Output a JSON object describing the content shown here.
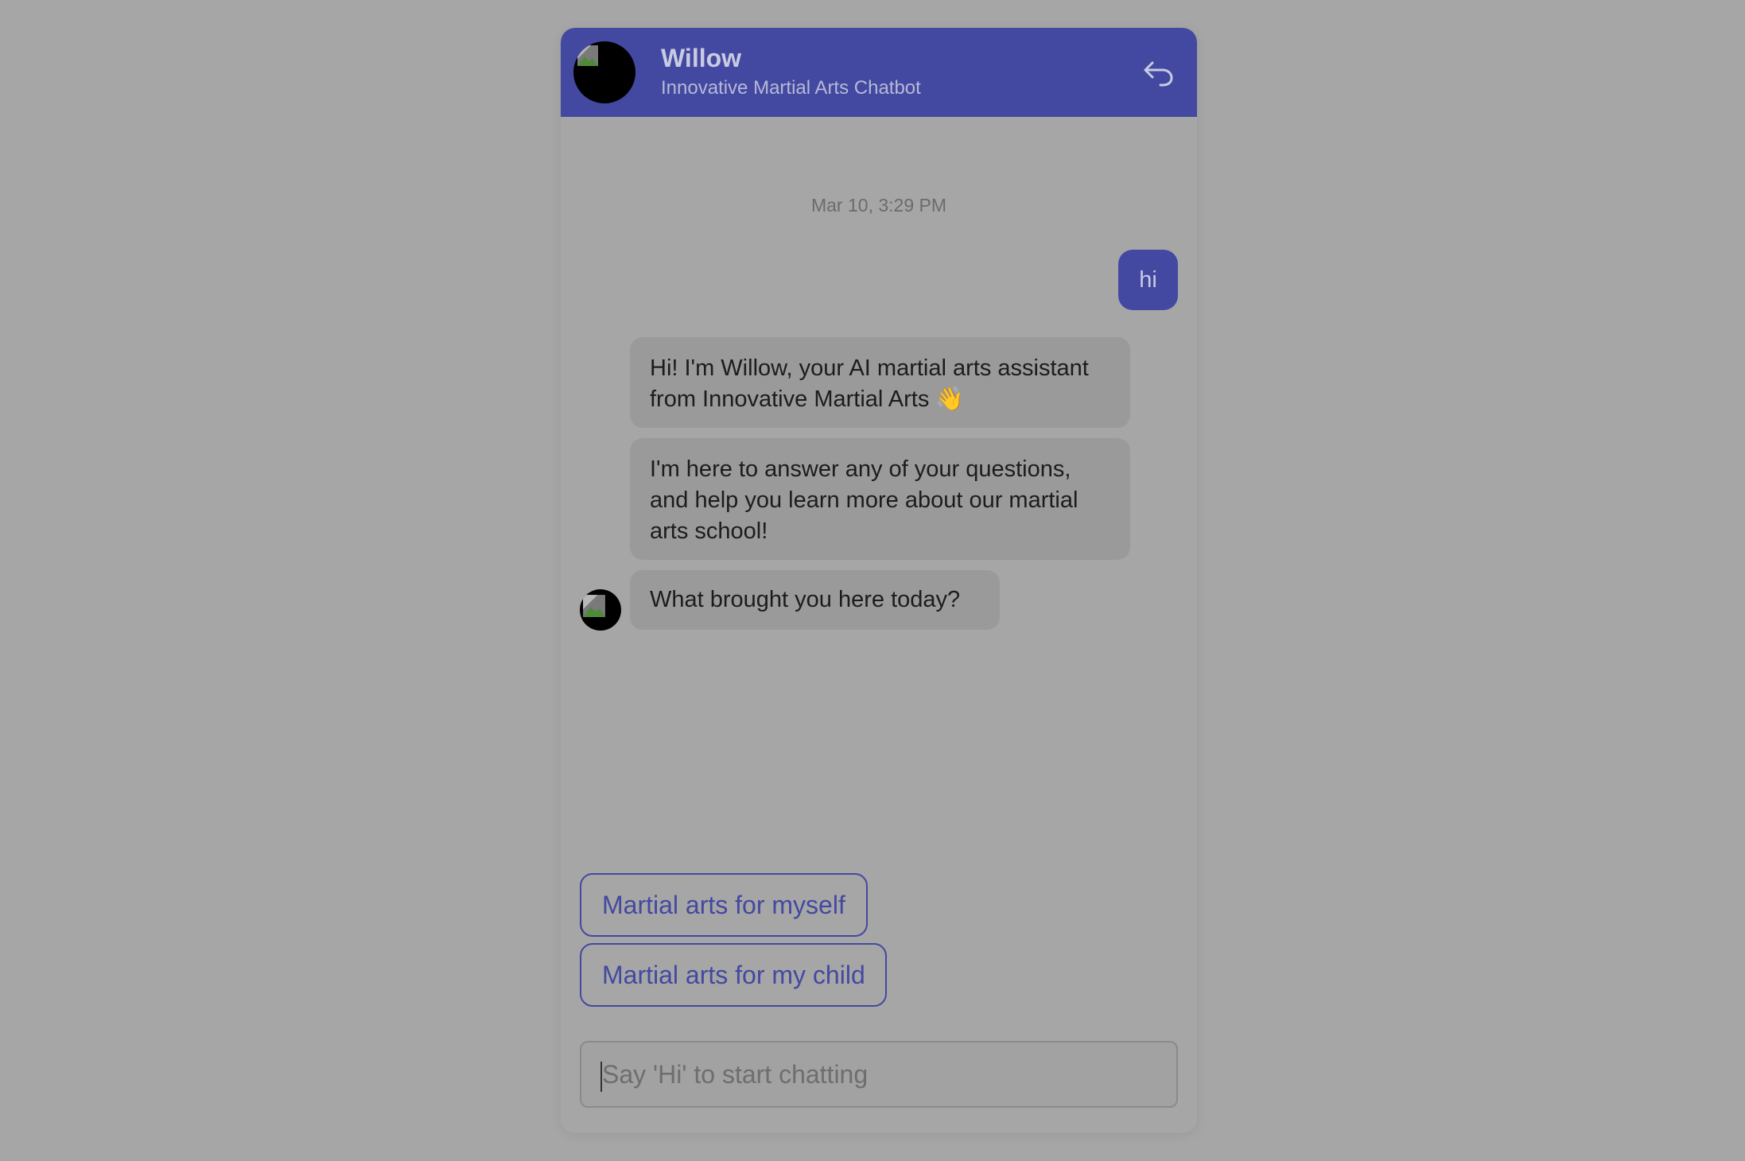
{
  "header": {
    "bot_name": "Willow",
    "subtitle": "Innovative Martial Arts Chatbot",
    "back_icon": "reply-arrow-icon",
    "avatar_icon": "broken-image-icon"
  },
  "conversation": {
    "timestamp": "Mar 10, 3:29 PM",
    "user_messages": [
      {
        "text": "hi"
      }
    ],
    "bot_messages": [
      {
        "text": "Hi! I'm Willow, your AI martial arts assistant from Innovative Martial Arts 👋"
      },
      {
        "text": "I'm here to answer any of your questions, and help you learn more about our martial arts school!"
      },
      {
        "text": "What brought you here today?"
      }
    ]
  },
  "quick_replies": [
    {
      "label": "Martial arts for myself"
    },
    {
      "label": "Martial arts for my child"
    }
  ],
  "composer": {
    "placeholder": "Say 'Hi' to start chatting",
    "value": ""
  },
  "colors": {
    "accent": "#4349a0",
    "overlay_background": "#a6a6a6",
    "bot_bubble": "#9a9a9a"
  }
}
